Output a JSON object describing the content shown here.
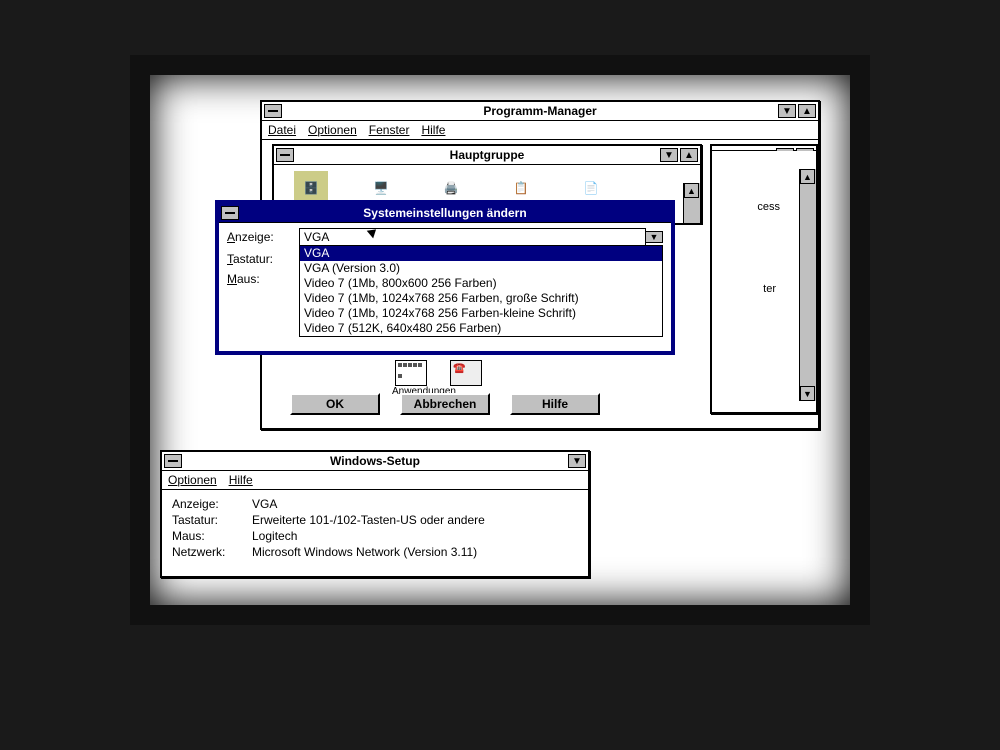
{
  "progman": {
    "title": "Programm-Manager",
    "menu": {
      "datei": "Datei",
      "optionen": "Optionen",
      "fenster": "Fenster",
      "hilfe": "Hilfe"
    }
  },
  "hauptgruppe": {
    "title": "Hauptgruppe",
    "icons": {
      "anwendungen": "Anwendungen"
    }
  },
  "dialog": {
    "title": "Systemeinstellungen ändern",
    "labels": {
      "anzeige": "Anzeige:",
      "tastatur": "Tastatur:",
      "maus": "Maus:"
    },
    "anzeige_value": "VGA",
    "options": [
      "VGA",
      "VGA (Version 3.0)",
      "Video 7 (1Mb, 800x600 256 Farben)",
      "Video 7 (1Mb, 1024x768 256 Farben, große Schrift)",
      "Video 7 (1Mb, 1024x768 256 Farben-kleine Schrift)",
      "Video 7 (512K, 640x480 256 Farben)"
    ],
    "buttons": {
      "ok": "OK",
      "abbrechen": "Abbrechen",
      "hilfe": "Hilfe"
    }
  },
  "setup": {
    "title": "Windows-Setup",
    "menu": {
      "optionen": "Optionen",
      "hilfe": "Hilfe"
    },
    "rows": {
      "anzeige_l": "Anzeige:",
      "anzeige_v": "VGA",
      "tastatur_l": "Tastatur:",
      "tastatur_v": "Erweiterte 101-/102-Tasten-US oder andere",
      "maus_l": "Maus:",
      "maus_v": "Logitech",
      "netzwerk_l": "Netzwerk:",
      "netzwerk_v": "Microsoft Windows Network (Version 3.11)"
    }
  },
  "partial_labels": {
    "access": "cess",
    "ter": "ter"
  }
}
